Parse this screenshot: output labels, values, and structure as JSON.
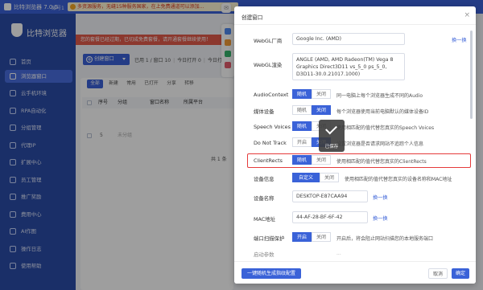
{
  "app": {
    "title": "比特浏览器 7.0.5",
    "account": "账号1",
    "banner": "多资源服务，无缝15种服务国家，在上免费通道可以添加..."
  },
  "sidebar": {
    "brand": "比特浏览器",
    "items": [
      {
        "label": "首页"
      },
      {
        "label": "浏览器窗口"
      },
      {
        "label": "云手机环境"
      },
      {
        "label": "RPA自动化"
      },
      {
        "label": "分组管理"
      },
      {
        "label": "代理IP"
      },
      {
        "label": "扩展中心"
      },
      {
        "label": "员工管理"
      },
      {
        "label": "推广奖励"
      },
      {
        "label": "费用中心"
      },
      {
        "label": "AI作图"
      },
      {
        "label": "操作日志"
      },
      {
        "label": "使用帮助"
      }
    ]
  },
  "main": {
    "alert": "您的套餐已经过期，已切成免费套餐，请开通套餐继续使用！",
    "notice": "",
    "create_label": "创建窗口",
    "stats": [
      "已用 1 / 窗口 10",
      "今日打开 0",
      "今日打开 0"
    ],
    "tabs": [
      "全部",
      "新建",
      "常用",
      "已打开",
      "分享",
      "转移"
    ],
    "headers": [
      "序号",
      "分组",
      "窗口名称",
      "所属平台"
    ],
    "rows": [
      {
        "index": "5",
        "group": "未分组"
      }
    ],
    "pager": "共 1 条"
  },
  "dialog": {
    "title": "创建窗口",
    "close": "×",
    "webgl_vendor_label": "WebGL厂商",
    "webgl_vendor": "Google Inc. (AMD)",
    "webgl_vendor_link": "换一换",
    "webgl_renderer_label": "WebGL渲染",
    "webgl_renderer": "ANGLE (AMD, AMD Radeon(TM) Vega 8 Graphics Direct3D11 vs_5_0 ps_5_0, D3D11-30.0.21017.1000)",
    "audio_label": "AudioContext",
    "audio_on": "随机",
    "audio_off": "关闭",
    "audio_desc": "同一电脑上每个浏览器生成不同的Audio",
    "media_label": "媒体设备",
    "media_on": "随机",
    "media_off": "关闭",
    "media_desc": "每个浏览器使用当前电脑默认的媒体设备ID",
    "speech_label": "Speech Voices",
    "speech_on": "随机",
    "speech_off": "关闭",
    "speech_desc": "使用相匹配的值代替您真实的Speech Voices",
    "dnt_label": "Do Not Track",
    "dnt_on": "开启",
    "dnt_off": "关闭",
    "dnt_desc": "设置浏览器是否请求网站不追踪个人信息",
    "clientrects_label": "ClientRects",
    "clientrects_on": "随机",
    "clientrects_off": "关闭",
    "clientrects_desc": "使用相匹配的值代替您真实的ClientRects",
    "device_label": "设备信息",
    "device_on": "自定义",
    "device_off": "关闭",
    "device_desc": "使用相匹配的值代替您真实的设备名称和MAC地址",
    "device_name_label": "设备名称",
    "device_name": "DESKTOP-E87CAA94",
    "device_name_link": "换一换",
    "mac_label": "MAC地址",
    "mac": "44-AF-28-BF-6F-42",
    "mac_link": "换一换",
    "port_label": "端口扫描保护",
    "port_on": "开启",
    "port_off": "关闭",
    "port_desc": "开启后，将会阻止网站扫描您的本地服务端口",
    "more_label": "启动参数",
    "more_desc": "...",
    "tooltip_text": "已保存",
    "footer_left": "一键随机生成指纹配置",
    "footer_cancel": "取消",
    "footer_ok": "确定"
  },
  "colors": {
    "brand": "#3a62d8",
    "sidebar": "#2b4ca8",
    "highlight": "#e53b3b"
  }
}
